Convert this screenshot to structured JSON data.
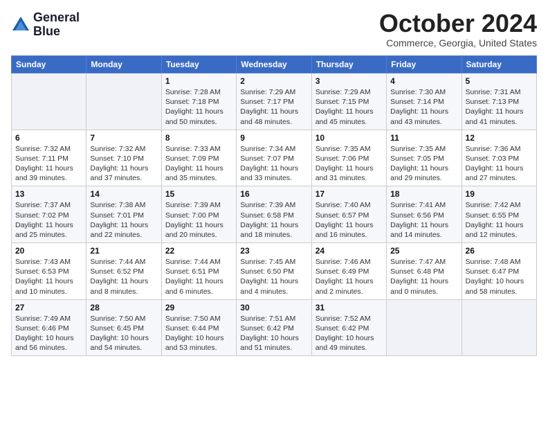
{
  "header": {
    "logo_line1": "General",
    "logo_line2": "Blue",
    "month": "October 2024",
    "location": "Commerce, Georgia, United States"
  },
  "weekdays": [
    "Sunday",
    "Monday",
    "Tuesday",
    "Wednesday",
    "Thursday",
    "Friday",
    "Saturday"
  ],
  "weeks": [
    [
      {
        "day": "",
        "info": ""
      },
      {
        "day": "",
        "info": ""
      },
      {
        "day": "1",
        "info": "Sunrise: 7:28 AM\nSunset: 7:18 PM\nDaylight: 11 hours and 50 minutes."
      },
      {
        "day": "2",
        "info": "Sunrise: 7:29 AM\nSunset: 7:17 PM\nDaylight: 11 hours and 48 minutes."
      },
      {
        "day": "3",
        "info": "Sunrise: 7:29 AM\nSunset: 7:15 PM\nDaylight: 11 hours and 45 minutes."
      },
      {
        "day": "4",
        "info": "Sunrise: 7:30 AM\nSunset: 7:14 PM\nDaylight: 11 hours and 43 minutes."
      },
      {
        "day": "5",
        "info": "Sunrise: 7:31 AM\nSunset: 7:13 PM\nDaylight: 11 hours and 41 minutes."
      }
    ],
    [
      {
        "day": "6",
        "info": "Sunrise: 7:32 AM\nSunset: 7:11 PM\nDaylight: 11 hours and 39 minutes."
      },
      {
        "day": "7",
        "info": "Sunrise: 7:32 AM\nSunset: 7:10 PM\nDaylight: 11 hours and 37 minutes."
      },
      {
        "day": "8",
        "info": "Sunrise: 7:33 AM\nSunset: 7:09 PM\nDaylight: 11 hours and 35 minutes."
      },
      {
        "day": "9",
        "info": "Sunrise: 7:34 AM\nSunset: 7:07 PM\nDaylight: 11 hours and 33 minutes."
      },
      {
        "day": "10",
        "info": "Sunrise: 7:35 AM\nSunset: 7:06 PM\nDaylight: 11 hours and 31 minutes."
      },
      {
        "day": "11",
        "info": "Sunrise: 7:35 AM\nSunset: 7:05 PM\nDaylight: 11 hours and 29 minutes."
      },
      {
        "day": "12",
        "info": "Sunrise: 7:36 AM\nSunset: 7:03 PM\nDaylight: 11 hours and 27 minutes."
      }
    ],
    [
      {
        "day": "13",
        "info": "Sunrise: 7:37 AM\nSunset: 7:02 PM\nDaylight: 11 hours and 25 minutes."
      },
      {
        "day": "14",
        "info": "Sunrise: 7:38 AM\nSunset: 7:01 PM\nDaylight: 11 hours and 22 minutes."
      },
      {
        "day": "15",
        "info": "Sunrise: 7:39 AM\nSunset: 7:00 PM\nDaylight: 11 hours and 20 minutes."
      },
      {
        "day": "16",
        "info": "Sunrise: 7:39 AM\nSunset: 6:58 PM\nDaylight: 11 hours and 18 minutes."
      },
      {
        "day": "17",
        "info": "Sunrise: 7:40 AM\nSunset: 6:57 PM\nDaylight: 11 hours and 16 minutes."
      },
      {
        "day": "18",
        "info": "Sunrise: 7:41 AM\nSunset: 6:56 PM\nDaylight: 11 hours and 14 minutes."
      },
      {
        "day": "19",
        "info": "Sunrise: 7:42 AM\nSunset: 6:55 PM\nDaylight: 11 hours and 12 minutes."
      }
    ],
    [
      {
        "day": "20",
        "info": "Sunrise: 7:43 AM\nSunset: 6:53 PM\nDaylight: 11 hours and 10 minutes."
      },
      {
        "day": "21",
        "info": "Sunrise: 7:44 AM\nSunset: 6:52 PM\nDaylight: 11 hours and 8 minutes."
      },
      {
        "day": "22",
        "info": "Sunrise: 7:44 AM\nSunset: 6:51 PM\nDaylight: 11 hours and 6 minutes."
      },
      {
        "day": "23",
        "info": "Sunrise: 7:45 AM\nSunset: 6:50 PM\nDaylight: 11 hours and 4 minutes."
      },
      {
        "day": "24",
        "info": "Sunrise: 7:46 AM\nSunset: 6:49 PM\nDaylight: 11 hours and 2 minutes."
      },
      {
        "day": "25",
        "info": "Sunrise: 7:47 AM\nSunset: 6:48 PM\nDaylight: 11 hours and 0 minutes."
      },
      {
        "day": "26",
        "info": "Sunrise: 7:48 AM\nSunset: 6:47 PM\nDaylight: 10 hours and 58 minutes."
      }
    ],
    [
      {
        "day": "27",
        "info": "Sunrise: 7:49 AM\nSunset: 6:46 PM\nDaylight: 10 hours and 56 minutes."
      },
      {
        "day": "28",
        "info": "Sunrise: 7:50 AM\nSunset: 6:45 PM\nDaylight: 10 hours and 54 minutes."
      },
      {
        "day": "29",
        "info": "Sunrise: 7:50 AM\nSunset: 6:44 PM\nDaylight: 10 hours and 53 minutes."
      },
      {
        "day": "30",
        "info": "Sunrise: 7:51 AM\nSunset: 6:42 PM\nDaylight: 10 hours and 51 minutes."
      },
      {
        "day": "31",
        "info": "Sunrise: 7:52 AM\nSunset: 6:42 PM\nDaylight: 10 hours and 49 minutes."
      },
      {
        "day": "",
        "info": ""
      },
      {
        "day": "",
        "info": ""
      }
    ]
  ]
}
